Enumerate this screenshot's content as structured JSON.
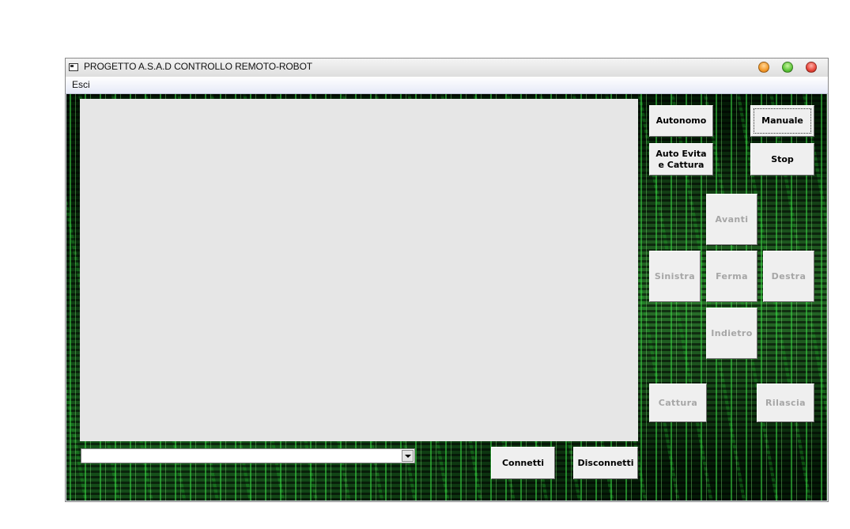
{
  "window": {
    "title": "PROGETTO A.S.A.D CONTROLLO REMOTO-ROBOT",
    "icon": "window-app-icon",
    "controls": {
      "minimize": "minimize-icon",
      "maximize": "maximize-icon",
      "close": "close-icon"
    }
  },
  "menu": {
    "items": [
      {
        "label": "Esci"
      }
    ]
  },
  "port_select": {
    "value": ""
  },
  "buttons": {
    "connetti": "Connetti",
    "disconnetti": "Disconnetti",
    "autonomo": "Autonomo",
    "manuale": "Manuale",
    "auto_evita": "Auto Evita\ne Cattura",
    "stop": "Stop",
    "avanti": "Avanti",
    "sinistra": "Sinistra",
    "ferma": "Ferma",
    "destra": "Destra",
    "indietro": "Indietro",
    "cattura": "Cattura",
    "rilascia": "Rilascia"
  },
  "colors": {
    "background_theme": "#0b3d10",
    "accent_green": "#3cdc46",
    "disabled_text": "#a6a6a6",
    "button_face": "#efefef"
  },
  "state": {
    "enabled_buttons": [
      "Connetti",
      "Disconnetti",
      "Autonomo",
      "Manuale",
      "Auto Evita e Cattura",
      "Stop"
    ],
    "disabled_buttons": [
      "Avanti",
      "Sinistra",
      "Ferma",
      "Destra",
      "Indietro",
      "Cattura",
      "Rilascia"
    ],
    "focused_button": "Manuale"
  }
}
